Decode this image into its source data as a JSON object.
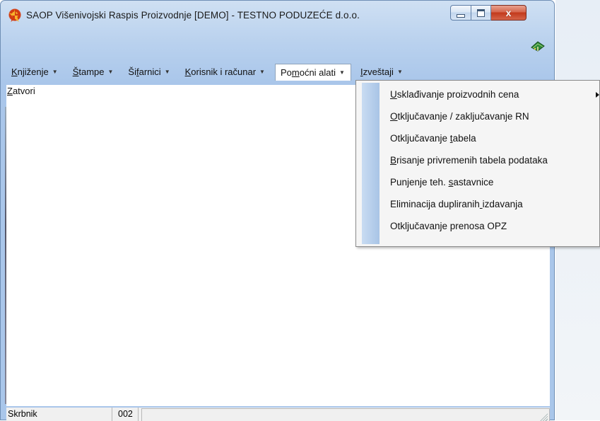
{
  "window": {
    "title": "SAOP  Višenivojski Raspis Proizvodnje [DEMO] - TESTNO PODUZEĆE d.o.o.",
    "close_glyph": "x"
  },
  "menu": [
    {
      "label": "Knjiženje",
      "mnemonic_index": 0
    },
    {
      "label": "Štampe",
      "mnemonic_index": 0
    },
    {
      "label": "Šifarnici",
      "mnemonic_index": 2
    },
    {
      "label": "Korisnik i računar",
      "mnemonic_index": 0
    },
    {
      "label": "Pomoćni alati",
      "mnemonic_index": 2
    },
    {
      "label": "Izveštaji",
      "mnemonic_index": 0
    }
  ],
  "open_menu": "Pomoćni alati",
  "toolbar": {
    "close_label": "Zatvori"
  },
  "dropdown_items": [
    {
      "label": "Usklađivanje proizvodnih cena",
      "mnemonic_index": 0,
      "submenu": true
    },
    {
      "label": "Otključavanje / zaključavanje RN",
      "mnemonic_index": 0
    },
    {
      "label": "Otključavanje tabela",
      "mnemonic_index": 14
    },
    {
      "label": "Brisanje privremenih tabela podataka",
      "mnemonic_index": 0
    },
    {
      "label": "Punjenje teh. sastavnice",
      "mnemonic_index": 14
    },
    {
      "label": "Eliminacija dupliranih izdavanja",
      "mnemonic_index": 22
    },
    {
      "label": "Otključavanje prenosa OPZ",
      "mnemonic_index": -1
    }
  ],
  "status": {
    "user": "Skrbnik",
    "code": "002"
  },
  "colors": {
    "window_frame": "#b9d1ee",
    "close_button": "#c2391b",
    "menu_gutter": "#a8c4e6"
  },
  "icons": {
    "app": "saop-logo-icon",
    "book": "book-icon"
  }
}
